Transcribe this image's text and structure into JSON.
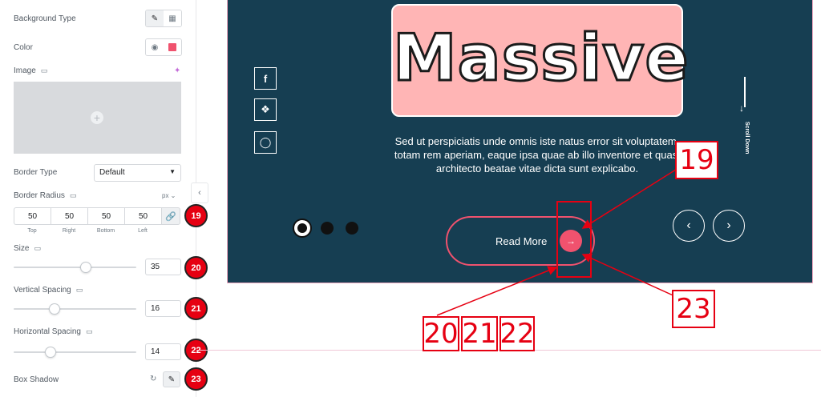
{
  "panel": {
    "background_type": {
      "label": "Background Type",
      "options": [
        "classic-brush-icon",
        "gradient-icon"
      ]
    },
    "color": {
      "label": "Color",
      "swatch": "#f0526e"
    },
    "image": {
      "label": "Image"
    },
    "border_type": {
      "label": "Border Type",
      "value": "Default"
    },
    "border_radius": {
      "label": "Border Radius",
      "unit": "px",
      "values": [
        "50",
        "50",
        "50",
        "50"
      ],
      "sublabels": [
        "Top",
        "Right",
        "Bottom",
        "Left"
      ]
    },
    "size": {
      "label": "Size",
      "value": "35",
      "level": 0.6
    },
    "vertical_spacing": {
      "label": "Vertical Spacing",
      "value": "16",
      "level": 0.32
    },
    "horizontal_spacing": {
      "label": "Horizontal Spacing",
      "value": "14",
      "level": 0.28
    },
    "box_shadow": {
      "label": "Box Shadow"
    },
    "badges": [
      "19",
      "20",
      "21",
      "22",
      "23"
    ]
  },
  "preview": {
    "hero_title": "Massive",
    "description": "Sed ut perspiciatis unde omnis iste natus error sit voluptatem, totam rem aperiam, eaque ipsa quae ab illo inventore et quasi architecto beatae vitae dicta sunt explicabo.",
    "scroll_text": "Scroll Down",
    "read_more": "Read More",
    "social_icons": [
      "facebook-icon",
      "twitter-icon",
      "instagram-icon"
    ],
    "colors": {
      "background": "#163e52",
      "accent": "#f0526e",
      "hero_box": "#ffb5b5"
    }
  },
  "annotations": {
    "label_19": "19",
    "label_23": "23",
    "label_20": "20",
    "label_21": "21",
    "label_22": "22",
    "color": "#e60012"
  }
}
